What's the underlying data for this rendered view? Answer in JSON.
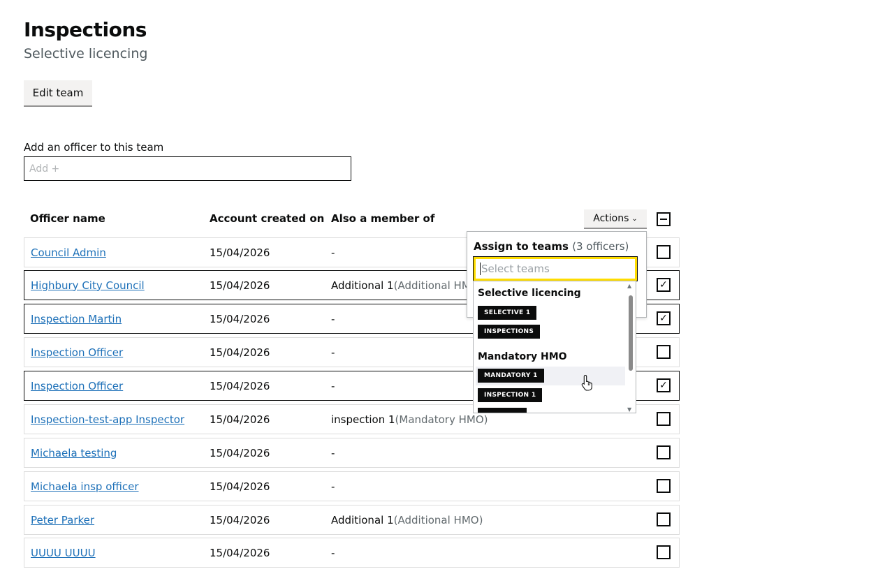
{
  "header": {
    "title": "Inspections",
    "caption": "Selective licencing",
    "edit_button": "Edit team"
  },
  "add_officer": {
    "label": "Add an officer to this team",
    "placeholder": "Add +"
  },
  "table": {
    "headers": {
      "name": "Officer name",
      "created": "Account created on",
      "member": "Also a member of"
    },
    "actions_label": "Actions",
    "rows": [
      {
        "name": "Council Admin",
        "date": "15/04/2026",
        "member": "-",
        "member_scheme": "",
        "selected": false
      },
      {
        "name": "Highbury City Council",
        "date": "15/04/2026",
        "member": "Additional 1",
        "member_scheme": "(Additional HM",
        "selected": true
      },
      {
        "name": "Inspection Martin",
        "date": "15/04/2026",
        "member": "-",
        "member_scheme": "",
        "selected": true
      },
      {
        "name": "Inspection Officer",
        "date": "15/04/2026",
        "member": "-",
        "member_scheme": "",
        "selected": false
      },
      {
        "name": "Inspection Officer",
        "date": "15/04/2026",
        "member": "-",
        "member_scheme": "",
        "selected": true
      },
      {
        "name": "Inspection-test-app Inspector",
        "date": "15/04/2026",
        "member": "inspection 1",
        "member_scheme": "(Mandatory HMO)",
        "selected": false
      },
      {
        "name": "Michaela testing",
        "date": "15/04/2026",
        "member": "-",
        "member_scheme": "",
        "selected": false
      },
      {
        "name": "Michaela insp officer",
        "date": "15/04/2026",
        "member": "-",
        "member_scheme": "",
        "selected": false
      },
      {
        "name": "Peter Parker",
        "date": "15/04/2026",
        "member": "Additional 1",
        "member_scheme": "(Additional HMO)",
        "selected": false
      },
      {
        "name": "UUUU UUUU",
        "date": "15/04/2026",
        "member": "-",
        "member_scheme": "",
        "selected": false
      }
    ]
  },
  "assign_dropdown": {
    "title": "Assign to teams",
    "count": "(3 officers)",
    "search_placeholder": "Select teams",
    "groups": [
      {
        "name": "Selective licencing",
        "teams": [
          "SELECTIVE 1",
          "INSPECTIONS"
        ]
      },
      {
        "name": "Mandatory HMO",
        "teams": [
          "MANDATORY 1",
          "INSPECTION 1"
        ]
      }
    ],
    "highlighted_team": "MANDATORY 1"
  },
  "colors": {
    "link": "#1d70b8",
    "text": "#0b0c0c",
    "focus": "#ffdd00",
    "tag_bg": "#0b0c0c",
    "muted": "#626a6e"
  },
  "icons": {
    "actions_chevron": "chevron-down-icon",
    "checkbox_checked": "checkmark-icon",
    "select_all": "indeterminate-dash-icon",
    "cursor": "hand-pointer-icon"
  }
}
